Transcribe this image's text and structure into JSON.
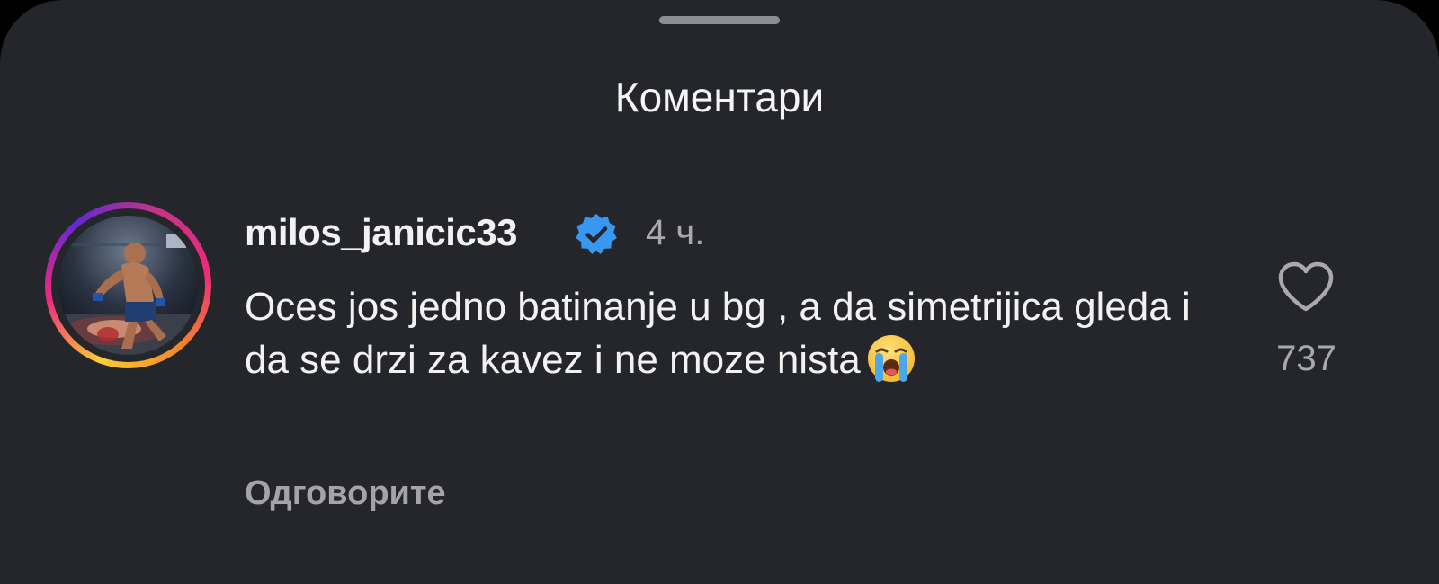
{
  "sheet": {
    "title": "Коментари"
  },
  "comment": {
    "username": "milos_janicic33",
    "verified": true,
    "timestamp": "4 ч.",
    "text": "Oces jos jedno batinanje u bg , a da simetrijica gleda i da se drzi za kavez i ne moze nista",
    "emoji": "loudly-crying-face",
    "reply_label": "Одговорите",
    "like_count": "737",
    "like_icon": "heart-outline-icon"
  },
  "colors": {
    "background": "#25262b",
    "verified_badge": "#3897f0",
    "primary_text": "#f2f2f2",
    "secondary_text": "#a8a8ad"
  }
}
